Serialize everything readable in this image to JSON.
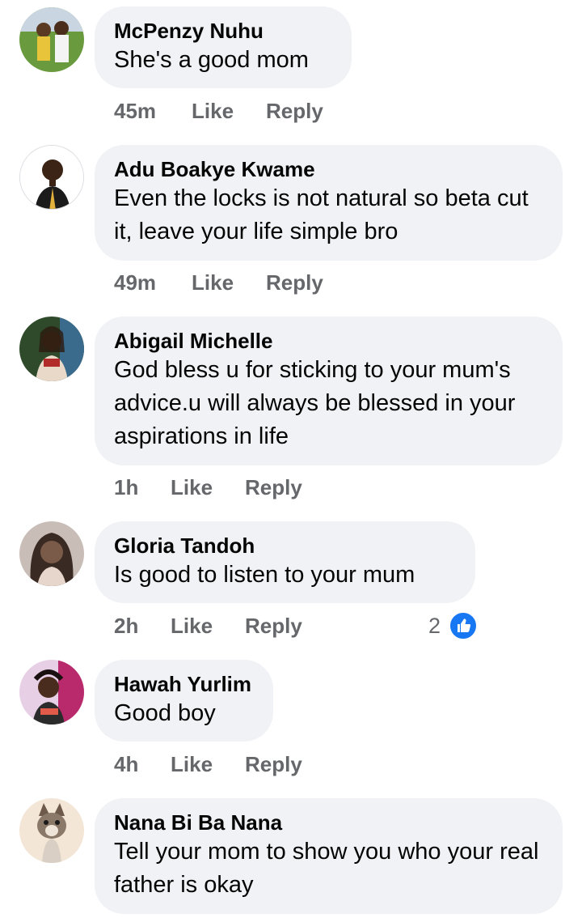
{
  "actions": {
    "like_label": "Like",
    "reply_label": "Reply"
  },
  "comments": [
    {
      "author": "McPenzy Nuhu",
      "text": "She's a good mom",
      "time": "45m"
    },
    {
      "author": "Adu Boakye Kwame",
      "text": "Even the locks is not natural so beta cut it, leave your life simple bro",
      "time": "49m"
    },
    {
      "author": "Abigail Michelle",
      "text": "God bless u for sticking to your mum's advice.u will always be blessed in your aspirations in life",
      "time": "1h"
    },
    {
      "author": "Gloria Tandoh",
      "text": "Is good to listen to your mum",
      "time": "2h",
      "reaction_count": "2",
      "reaction_icon": "like-reaction-icon"
    },
    {
      "author": "Hawah Yurlim",
      "text": "Good boy",
      "time": "4h"
    },
    {
      "author": "Nana Bi Ba Nana",
      "text": "Tell your mom to show you who your real father is okay"
    }
  ],
  "colors": {
    "bubble": "#f0f2f5",
    "meta_text": "#65676b",
    "like_blue": "#1877f2"
  }
}
